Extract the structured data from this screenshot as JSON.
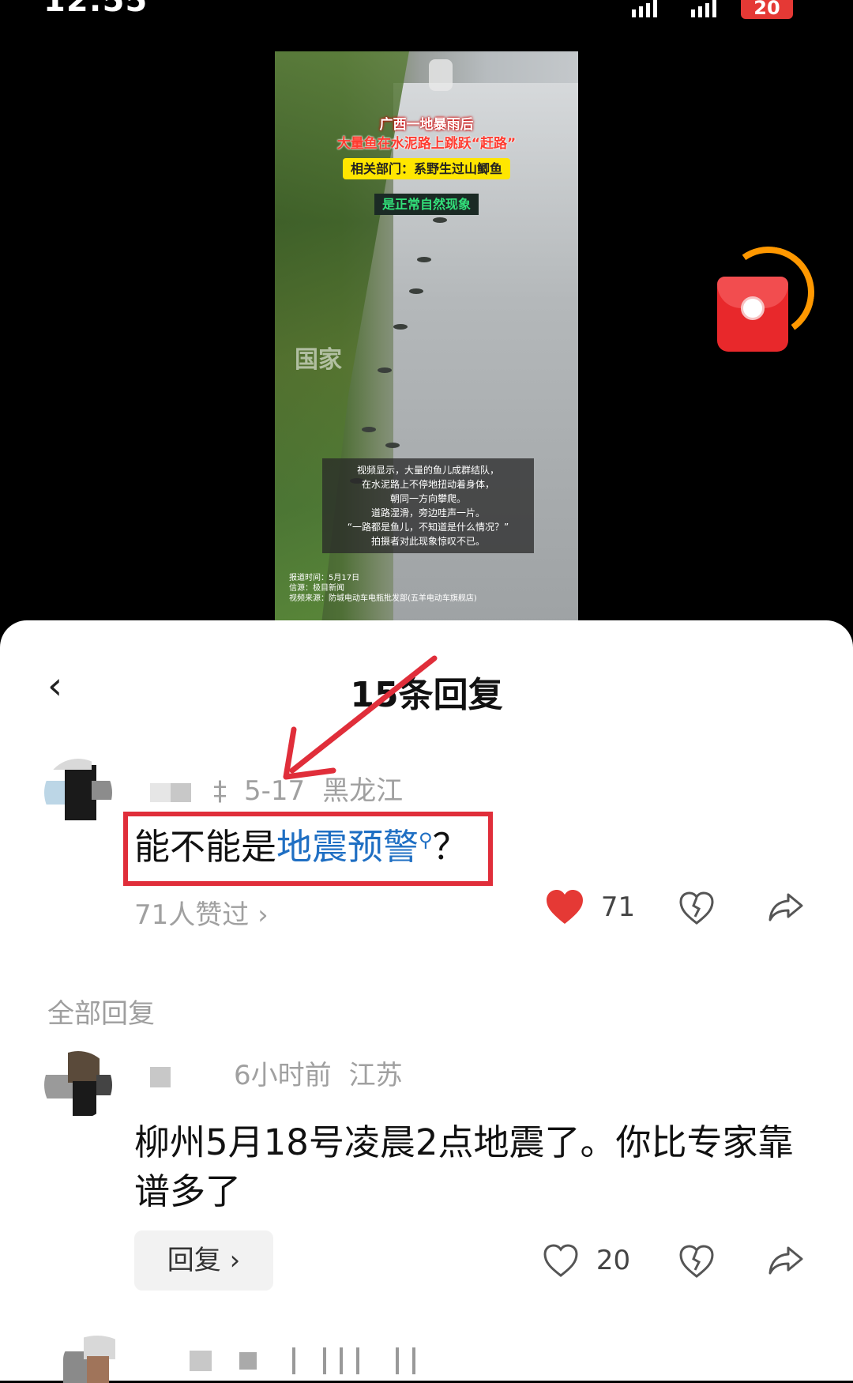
{
  "status_bar": {
    "time": "12:55",
    "battery": "20"
  },
  "video": {
    "caption_line1": "广西一地暴雨后",
    "caption_line2": "大量鱼在水泥路上跳跃“赶路”",
    "caption_yellow": "相关部门：系野生过山鲫鱼",
    "caption_green": "是正常自然现象",
    "description_lines": [
      "视频显示，大量的鱼儿成群结队，",
      "在水泥路上不停地扭动着身体，",
      "朝同一方向攀爬。",
      "道路湿滑，旁边哇声一片。",
      "“一路都是鱼儿，不知道是什么情况？”",
      "拍摄者对此现象惊叹不已。"
    ],
    "meta_lines": [
      "报道时间：5月17日",
      "信源：极目新闻",
      "视频来源：防城电动车电瓶批发部(五羊电动车旗舰店)"
    ],
    "watermark": "国家"
  },
  "sheet": {
    "title": "15条回复",
    "main_comment": {
      "author_suffix": "‡",
      "date": "5-17",
      "location": "黑龙江",
      "text_prefix": "能不能是",
      "text_link": "地震预警",
      "text_suffix": "？",
      "likes_link": "71人赞过 ›",
      "like_count": "71"
    },
    "all_replies_label": "全部回复",
    "reply": {
      "time": "6小时前",
      "location": "江苏",
      "text": "柳州5月18号凌晨2点地震了。你比专家靠谱多了",
      "reply_button": "回复 ›",
      "like_count": "20"
    }
  },
  "colors": {
    "highlight": "#e02e3a",
    "link": "#1f6fc3",
    "liked": "#e53935",
    "red_packet": "#e8282b"
  }
}
